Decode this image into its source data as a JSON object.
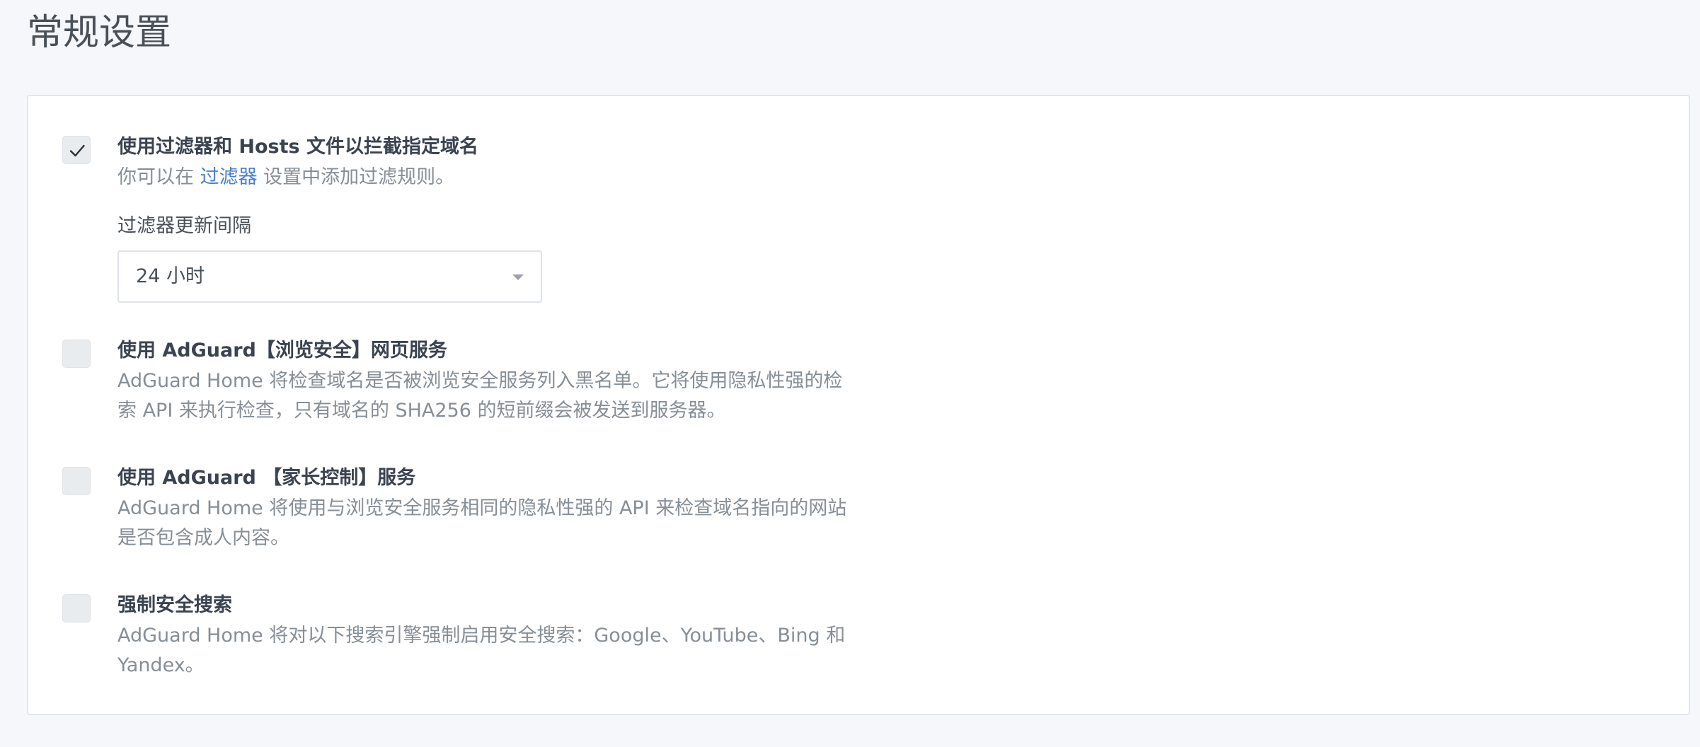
{
  "page": {
    "title": "常规设置"
  },
  "settings": [
    {
      "title": "使用过滤器和 Hosts 文件以拦截指定域名",
      "checked": true,
      "desc_before": "你可以在 ",
      "desc_link": "过滤器",
      "desc_after": " 设置中添加过滤规则。",
      "interval_label": "过滤器更新间隔",
      "interval_value": "24 小时"
    },
    {
      "title": "使用 AdGuard【浏览安全】网页服务",
      "checked": false,
      "desc": "AdGuard Home 将检查域名是否被浏览安全服务列入黑名单。它将使用隐私性强的检索 API 来执行检查，只有域名的 SHA256 的短前缀会被发送到服务器。"
    },
    {
      "title": "使用 AdGuard 【家长控制】服务",
      "checked": false,
      "desc": "AdGuard Home 将使用与浏览安全服务相同的隐私性强的 API 来检查域名指向的网站是否包含成人内容。"
    },
    {
      "title": "强制安全搜索",
      "checked": false,
      "desc": "AdGuard Home 将对以下搜索引擎强制启用安全搜索：Google、YouTube、Bing 和 Yandex。"
    }
  ],
  "icons": {
    "checkmark": "check-icon",
    "dropdown": "caret-down-icon"
  },
  "colors": {
    "background": "#f5f7fb",
    "card": "#ffffff",
    "link": "#467fcf",
    "checkbox": "#e9ecef"
  }
}
